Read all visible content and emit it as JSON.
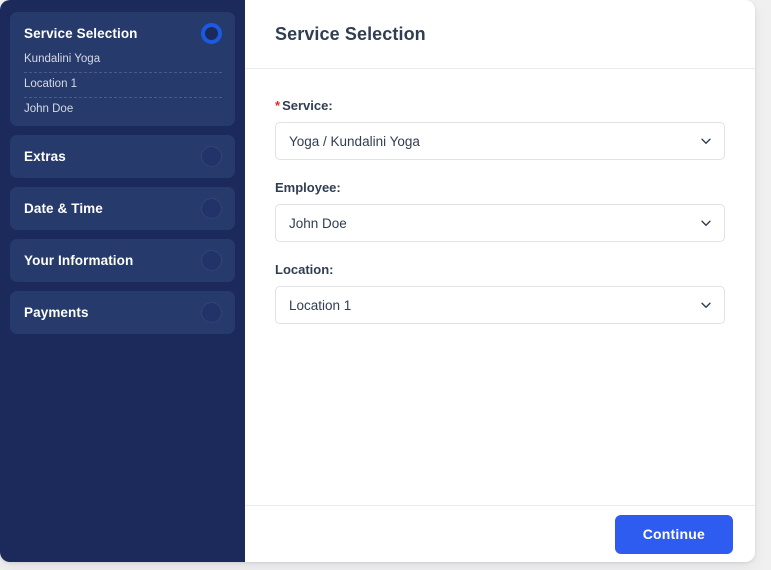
{
  "sidebar": {
    "steps": [
      {
        "label": "Service Selection",
        "active": true,
        "sub_items": [
          "Kundalini Yoga",
          "Location 1",
          "John Doe"
        ]
      },
      {
        "label": "Extras",
        "active": false,
        "sub_items": []
      },
      {
        "label": "Date & Time",
        "active": false,
        "sub_items": []
      },
      {
        "label": "Your Information",
        "active": false,
        "sub_items": []
      },
      {
        "label": "Payments",
        "active": false,
        "sub_items": []
      }
    ]
  },
  "main": {
    "title": "Service Selection",
    "fields": [
      {
        "label": "Service:",
        "required": true,
        "value": "Yoga / Kundalini Yoga",
        "icon": "chevron-down-icon"
      },
      {
        "label": "Employee:",
        "required": false,
        "value": "John Doe",
        "icon": "chevron-down-icon"
      },
      {
        "label": "Location:",
        "required": false,
        "value": "Location 1",
        "icon": "chevron-down-icon"
      }
    ]
  },
  "footer": {
    "continue_label": "Continue"
  },
  "colors": {
    "sidebar_bg": "#1b2a5b",
    "step_bg": "#263a6b",
    "accent_blue": "#2f5cf0",
    "active_ring": "#1b5ae0",
    "required_red": "#e02b2b",
    "text_dark": "#303e52",
    "page_bg": "#f0f0f1"
  }
}
